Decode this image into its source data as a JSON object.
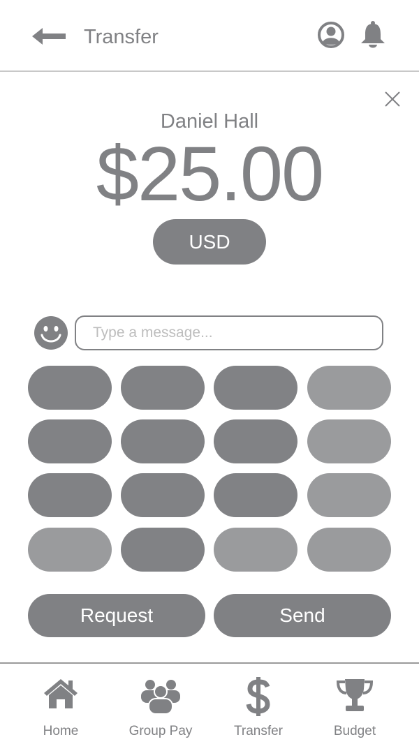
{
  "header": {
    "title": "Transfer",
    "icons": {
      "back": "arrow-left-icon",
      "profile": "user-circle-icon",
      "notifications": "bell-icon"
    }
  },
  "transfer": {
    "recipient": "Daniel Hall",
    "amount": "$25.00",
    "currency": "USD",
    "close_icon": "close-icon"
  },
  "message": {
    "placeholder": "Type a message...",
    "value": "",
    "emoji_icon": "smiley-icon"
  },
  "keypad": {
    "rows": [
      [
        "dark",
        "dark",
        "dark",
        "light"
      ],
      [
        "dark",
        "dark",
        "dark",
        "light"
      ],
      [
        "dark",
        "dark",
        "dark",
        "light"
      ],
      [
        "light",
        "dark",
        "light",
        "light"
      ]
    ]
  },
  "actions": {
    "request_label": "Request",
    "send_label": "Send"
  },
  "nav": {
    "items": [
      {
        "label": "Home",
        "icon": "home-icon"
      },
      {
        "label": "Group Pay",
        "icon": "group-icon"
      },
      {
        "label": "Transfer",
        "icon": "dollar-icon"
      },
      {
        "label": "Budget",
        "icon": "trophy-icon"
      }
    ]
  },
  "colors": {
    "primary_gray": "#808184",
    "light_gray": "#9a9b9d",
    "placeholder_gray": "#bdbdbd",
    "background": "#ffffff"
  }
}
